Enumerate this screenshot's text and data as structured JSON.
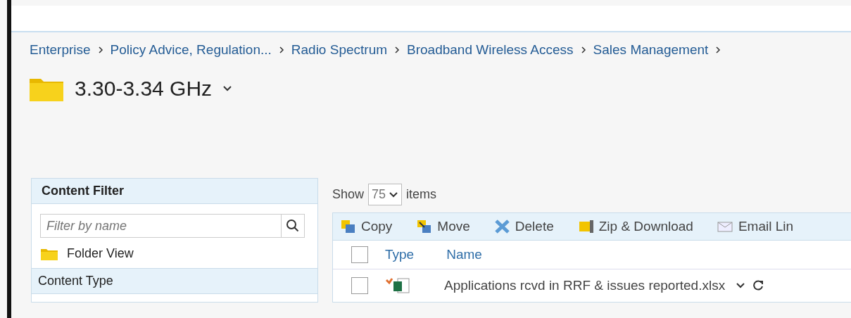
{
  "breadcrumb": [
    "Enterprise",
    "Policy Advice, Regulation...",
    "Radio Spectrum",
    "Broadband Wireless Access",
    "Sales Management"
  ],
  "folder": {
    "title": "3.30-3.34 GHz"
  },
  "filter_panel": {
    "title": "Content Filter",
    "search": {
      "placeholder": "Filter by name"
    },
    "folder_view": "Folder View",
    "section": "Content Type"
  },
  "list": {
    "show_label": "Show",
    "page_size": "75",
    "items_label": "items",
    "toolbar": [
      {
        "kind": "copy",
        "label": "Copy"
      },
      {
        "kind": "move",
        "label": "Move"
      },
      {
        "kind": "delete",
        "label": "Delete"
      },
      {
        "kind": "zip",
        "label": "Zip & Download"
      },
      {
        "kind": "email",
        "label": "Email Lin"
      }
    ],
    "columns": [
      "Type",
      "Name"
    ],
    "select_all_checked": false,
    "rows": [
      {
        "name": "Applications rcvd in RRF & issues reported.xlsx",
        "checked": false
      }
    ]
  }
}
